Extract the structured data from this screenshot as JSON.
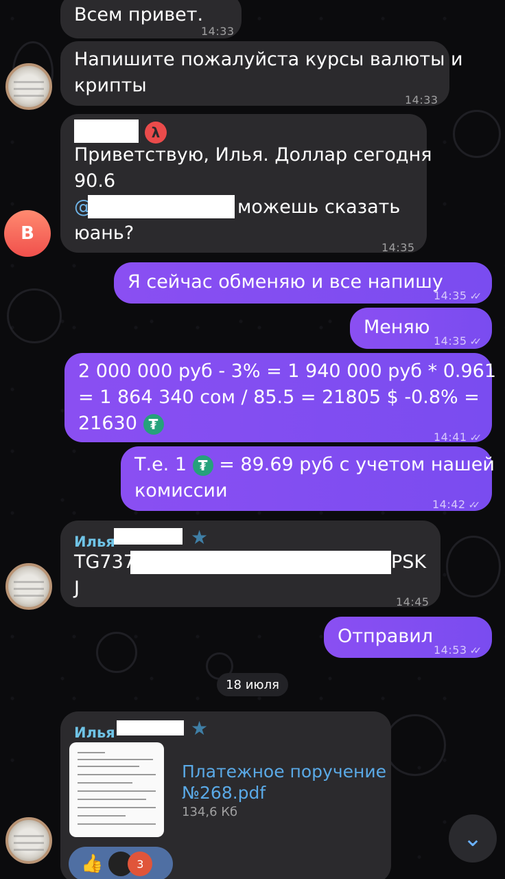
{
  "messages": {
    "m1": {
      "text": "Всем привет.",
      "time": "14:33"
    },
    "m2": {
      "line1": "Напишите пожалуйста курсы валюты и",
      "line2": "крипты",
      "time": "14:33"
    },
    "m3": {
      "badge": "λ",
      "line1": "Приветствую, Илья. Доллар сегодня",
      "line2": "90.6",
      "mention_prefix": "@",
      "line3_suffix": "можешь сказать",
      "line4": "юань?",
      "time": "14:35",
      "avatar_letter": "В"
    },
    "m4": {
      "text": "Я сейчас обменяю и все напишу",
      "time": "14:35"
    },
    "m5": {
      "text": "Меняю",
      "time": "14:35"
    },
    "m6": {
      "line1": "2 000 000 руб - 3% = 1 940 000 руб * 0.961",
      "line2": "= 1 864 340 сом / 85.5 = 21805 $ -0.8% =",
      "line3": "21630",
      "time": "14:41"
    },
    "m7": {
      "line1_a": "Т.е. 1",
      "line1_b": "= 89.69 руб с учетом нашей",
      "line2": "комиссии",
      "time": "14:42"
    },
    "m8": {
      "sender": "Илья",
      "code_start": "TG737",
      "code_end": "PSK",
      "line2": "J",
      "time": "14:45"
    },
    "m9": {
      "text": "Отправил",
      "time": "14:53"
    },
    "date_separator": "18 июля",
    "file_msg": {
      "sender": "Илья",
      "file_name_line1": "Платежное поручение",
      "file_name_line2": "№268.pdf",
      "file_size": "134,6 Кб",
      "reaction_emoji": "👍",
      "reaction_count": "3"
    }
  },
  "icons": {
    "read_ticks": "✓✓",
    "tether_glyph": "₮",
    "star": "★",
    "chevron_down": "⌄"
  },
  "colors": {
    "outgoing": "#7c4df0",
    "incoming": "#2b2a2d",
    "sender_name": "#6fc3e6",
    "file_link": "#5aa9e6",
    "tether": "#26a17b"
  }
}
